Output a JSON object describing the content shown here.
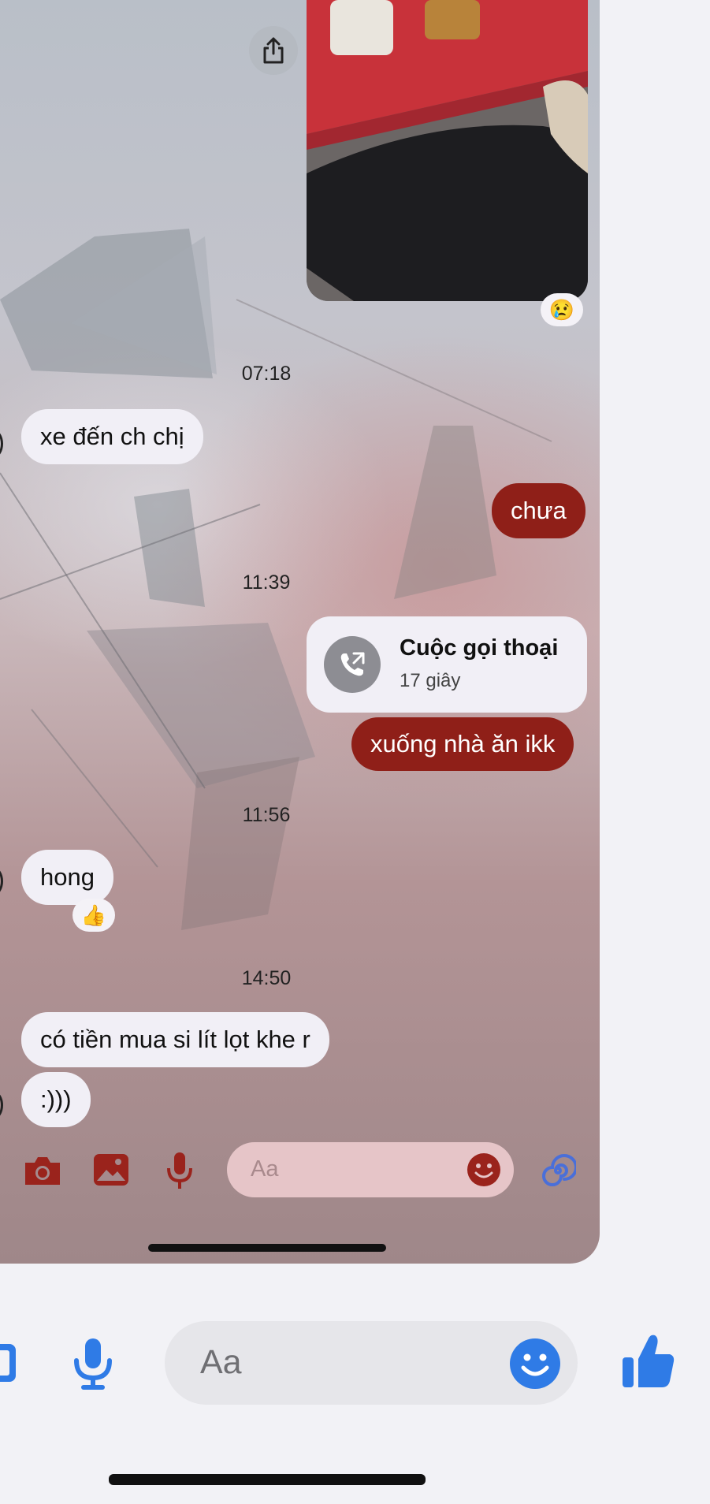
{
  "thread": {
    "share_label": "share",
    "photo_reaction": "😢",
    "messages": [
      {
        "time": "07:18"
      },
      {
        "incoming_1": "xe đến ch chị"
      },
      {
        "outgoing_1": "chưa"
      },
      {
        "time": "11:39"
      }
    ],
    "time_1": "07:18",
    "msg_in_1": "xe đến ch chị",
    "msg_out_1": "chưa",
    "time_2": "11:39",
    "call": {
      "title": "Cuộc gọi thoại",
      "duration": "17 giây"
    },
    "msg_out_2": "xuống nhà ăn ikk",
    "time_3": "11:56",
    "msg_in_2": "hong",
    "msg_in_2_reaction": "👍",
    "time_4": "14:50",
    "msg_in_3": "có tiền mua si lít lọt khe r",
    "msg_in_4": ":)))"
  },
  "inner_composer": {
    "placeholder": "Aa",
    "icons": [
      "camera-icon",
      "gallery-icon",
      "microphone-icon",
      "emoji-icon",
      "theme-swirl-icon"
    ]
  },
  "outer_composer": {
    "placeholder": "Aa",
    "icons": [
      "gallery-icon",
      "microphone-icon",
      "emoji-icon",
      "thumbs-up-icon"
    ]
  },
  "colors": {
    "outgoing_bubble": "#8f1f18",
    "incoming_bubble": "#f1eff6",
    "inner_icon": "#9a231c",
    "outer_icon": "#2f7be6"
  }
}
